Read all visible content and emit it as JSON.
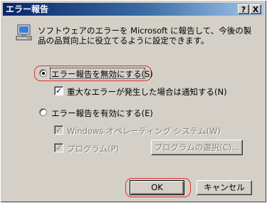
{
  "window": {
    "title": "エラー報告",
    "help_label": "?",
    "close_label": "X"
  },
  "description": "ソフトウェアのエラーを Microsoft に報告して、今後の製品の品質向上に役立てるように設定できます。",
  "options": {
    "disable_reporting": {
      "label": "エラー報告を無効にする(S)",
      "selected": true
    },
    "notify_critical": {
      "label": "重大なエラーが発生した場合は通知する(N)",
      "checked": true
    },
    "enable_reporting": {
      "label": "エラー報告を有効にする(E)",
      "selected": false
    },
    "windows_os": {
      "label": "Windows オペレーティング システム(W)",
      "checked": true,
      "enabled": false
    },
    "programs": {
      "label": "プログラム(P)",
      "checked": true,
      "enabled": false
    }
  },
  "buttons": {
    "select_programs": "プログラムの選択(C)...",
    "ok": "OK",
    "cancel": "キャンセル"
  },
  "colors": {
    "highlight": "#e03030",
    "titlebar": "#0a246a"
  },
  "icons": {
    "info_icon": "computer-icon"
  }
}
